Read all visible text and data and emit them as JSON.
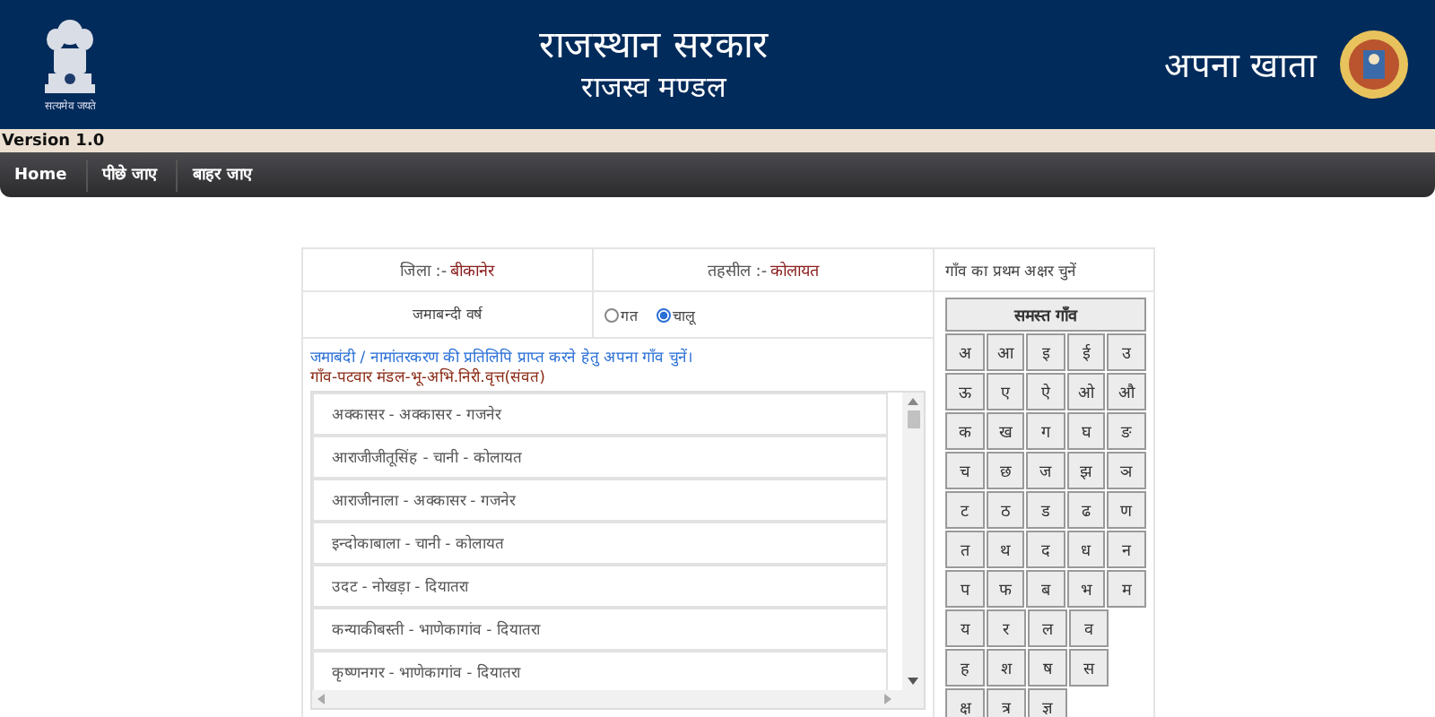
{
  "header": {
    "emblem_motto": "सत्यमेव जयते",
    "title": "राजस्थान सरकार",
    "subtitle": "राजस्व मण्डल",
    "app_name": "अपना खाता"
  },
  "version": "Version 1.0",
  "nav": [
    "Home",
    "पीछे जाए",
    "बाहर जाए"
  ],
  "district": {
    "label": "जिला :-",
    "value": "बीकानेर"
  },
  "tehsil": {
    "label": "तहसील :-",
    "value": "कोलायत"
  },
  "letter_prompt": "गाँव का प्रथम अक्षर चुनें",
  "year_label": "जमाबन्दी वर्ष",
  "year_options": [
    {
      "label": "गत",
      "selected": false
    },
    {
      "label": "चालू",
      "selected": true
    }
  ],
  "instruction": "जमाबंदी / नामांतरकरण की प्रतिलिपि प्राप्त करने हेतु अपना गाँव चुनें।",
  "list_heading": "गाँव-पटवार मंडल-भू-अभि.निरी.वृत्त(संवत)",
  "villages": [
    "अक्कासर - अक्कासर - गजनेर",
    "आराजीजीतूसिंह - चानी - कोलायत",
    "आराजीनाला - अक्कासर - गजनेर",
    "इन्दोकाबाला - चानी - कोलायत",
    "उदट - नोखड़ा - दियातरा",
    "कन्याकीबस्ती - भाणेकागांव - दियातरा",
    "कृष्णनगर - भाणेकागांव - दियातरा"
  ],
  "all_villages_button": "समस्त गाँव",
  "letters": [
    [
      "अ",
      "आ",
      "इ",
      "ई",
      "उ"
    ],
    [
      "ऊ",
      "ए",
      "ऐ",
      "ओ",
      "औ"
    ],
    [
      "क",
      "ख",
      "ग",
      "घ",
      "ङ"
    ],
    [
      "च",
      "छ",
      "ज",
      "झ",
      "ञ"
    ],
    [
      "ट",
      "ठ",
      "ड",
      "ढ",
      "ण"
    ],
    [
      "त",
      "थ",
      "द",
      "ध",
      "न"
    ],
    [
      "प",
      "फ",
      "ब",
      "भ",
      "म"
    ],
    [
      "य",
      "र",
      "ल",
      "व"
    ],
    [
      "ह",
      "श",
      "ष",
      "स"
    ],
    [
      "क्ष",
      "त्र",
      "ज्ञ"
    ]
  ]
}
